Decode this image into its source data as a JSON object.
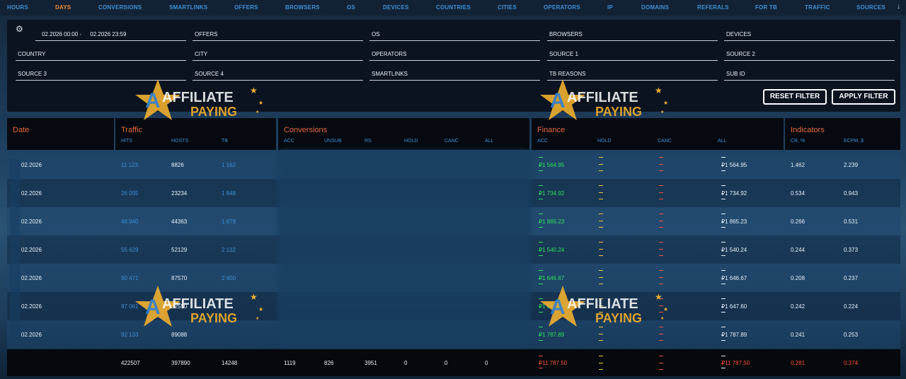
{
  "nav": {
    "tabs": [
      "HOURS",
      "DAYS",
      "CONVERSIONS",
      "SMARTLINKS",
      "OFFERS",
      "BROWSERS",
      "OS",
      "DEVICES",
      "COUNTRIES",
      "CITIES",
      "OPERATORS",
      "IP",
      "DOMAINS",
      "REFERALS",
      "FOR TB",
      "TRAFFIC",
      "SOURCES"
    ],
    "active": "DAYS",
    "arrow_icon": "arrow-down-icon"
  },
  "filters": {
    "date_from": "02.2026 00:00 -",
    "date_to": "02.2026 23:59",
    "fields": [
      "OFFERS",
      "OS",
      "BROWSERS",
      "DEVICES",
      "COUNTRY",
      "CITY",
      "OPERATORS",
      "SOURCE 1",
      "SOURCE 2",
      "SOURCE 3",
      "SOURCE 4",
      "SMARTLINKS",
      "TB REASONS",
      "SUB ID"
    ],
    "reset_label": "RESET FILTER",
    "apply_label": "APPLY FILTER"
  },
  "table": {
    "groups": {
      "date": "Date",
      "traffic": "Traffic",
      "conversions": "Conversions",
      "finance": "Finance",
      "indicators": "Indicators"
    },
    "traffic_cols": [
      "HITS",
      "HOSTS",
      "TB"
    ],
    "conversion_cols": [
      "ACC",
      "UNSUB",
      "RS",
      "HOLD",
      "CANC",
      "ALL"
    ],
    "finance_cols": [
      "ACC",
      "HOLD",
      "CANC",
      "ALL"
    ],
    "indicator_cols": [
      "CR, %",
      "ECPM, $"
    ],
    "rows": [
      {
        "date": "02.2026",
        "hits": "11 123",
        "hosts": "8826",
        "tb": "1 162",
        "fin_acc": "₽1 564.95",
        "fin_all": "₽1 564.95",
        "cr": "1.462",
        "ecpm": "2.239"
      },
      {
        "date": "02.2026",
        "hits": "26 055",
        "hosts": "23234",
        "tb": "1 848",
        "fin_acc": "₽1 734.92",
        "fin_all": "₽1 734.92",
        "cr": "0.534",
        "ecpm": "0.943"
      },
      {
        "date": "02.2026",
        "hits": "46 940",
        "hosts": "44363",
        "tb": "1 678",
        "fin_acc": "₽1 865.23",
        "fin_all": "₽1 865.23",
        "cr": "0.266",
        "ecpm": "0.531"
      },
      {
        "date": "02.2026",
        "hits": "55 629",
        "hosts": "52129",
        "tb": "2 132",
        "fin_acc": "₽1 540.24",
        "fin_all": "₽1 540.24",
        "cr": "0.244",
        "ecpm": "0.373"
      },
      {
        "date": "02.2026",
        "hits": "90 471",
        "hosts": "87570",
        "tb": "2 400",
        "fin_acc": "₽1 646.67",
        "fin_all": "₽1 646.67",
        "cr": "0.208",
        "ecpm": "0.237"
      },
      {
        "date": "02.2026",
        "hits": "97 061",
        "hosts": "92550",
        "tb": "",
        "fin_acc": "₽1 647.60",
        "fin_all": "₽1 647.60",
        "cr": "0.242",
        "ecpm": "0.224"
      },
      {
        "date": "02.2026",
        "hits": "92 133",
        "hosts": "89088",
        "tb": "",
        "fin_acc": "₽1 787.89",
        "fin_all": "₽1 787.89",
        "cr": "0.241",
        "ecpm": "0.253"
      }
    ],
    "total": {
      "hits": "422507",
      "hosts": "397890",
      "tb": "14248",
      "acc": "1119",
      "unsub": "826",
      "rs": "3951",
      "hold": "0",
      "canc": "0",
      "all": "0",
      "fin_acc": "₽11 787.50",
      "fin_all": "₽11 787.50",
      "cr": "0.281",
      "ecpm": "0.374"
    }
  },
  "watermark": {
    "line1": "AFFILIATE",
    "line2": "PAYING"
  },
  "colors": {
    "accent_orange": "#e8673b",
    "link_blue": "#3d8fd8",
    "money_green": "#2ee05a",
    "total_red": "#ff5030"
  }
}
